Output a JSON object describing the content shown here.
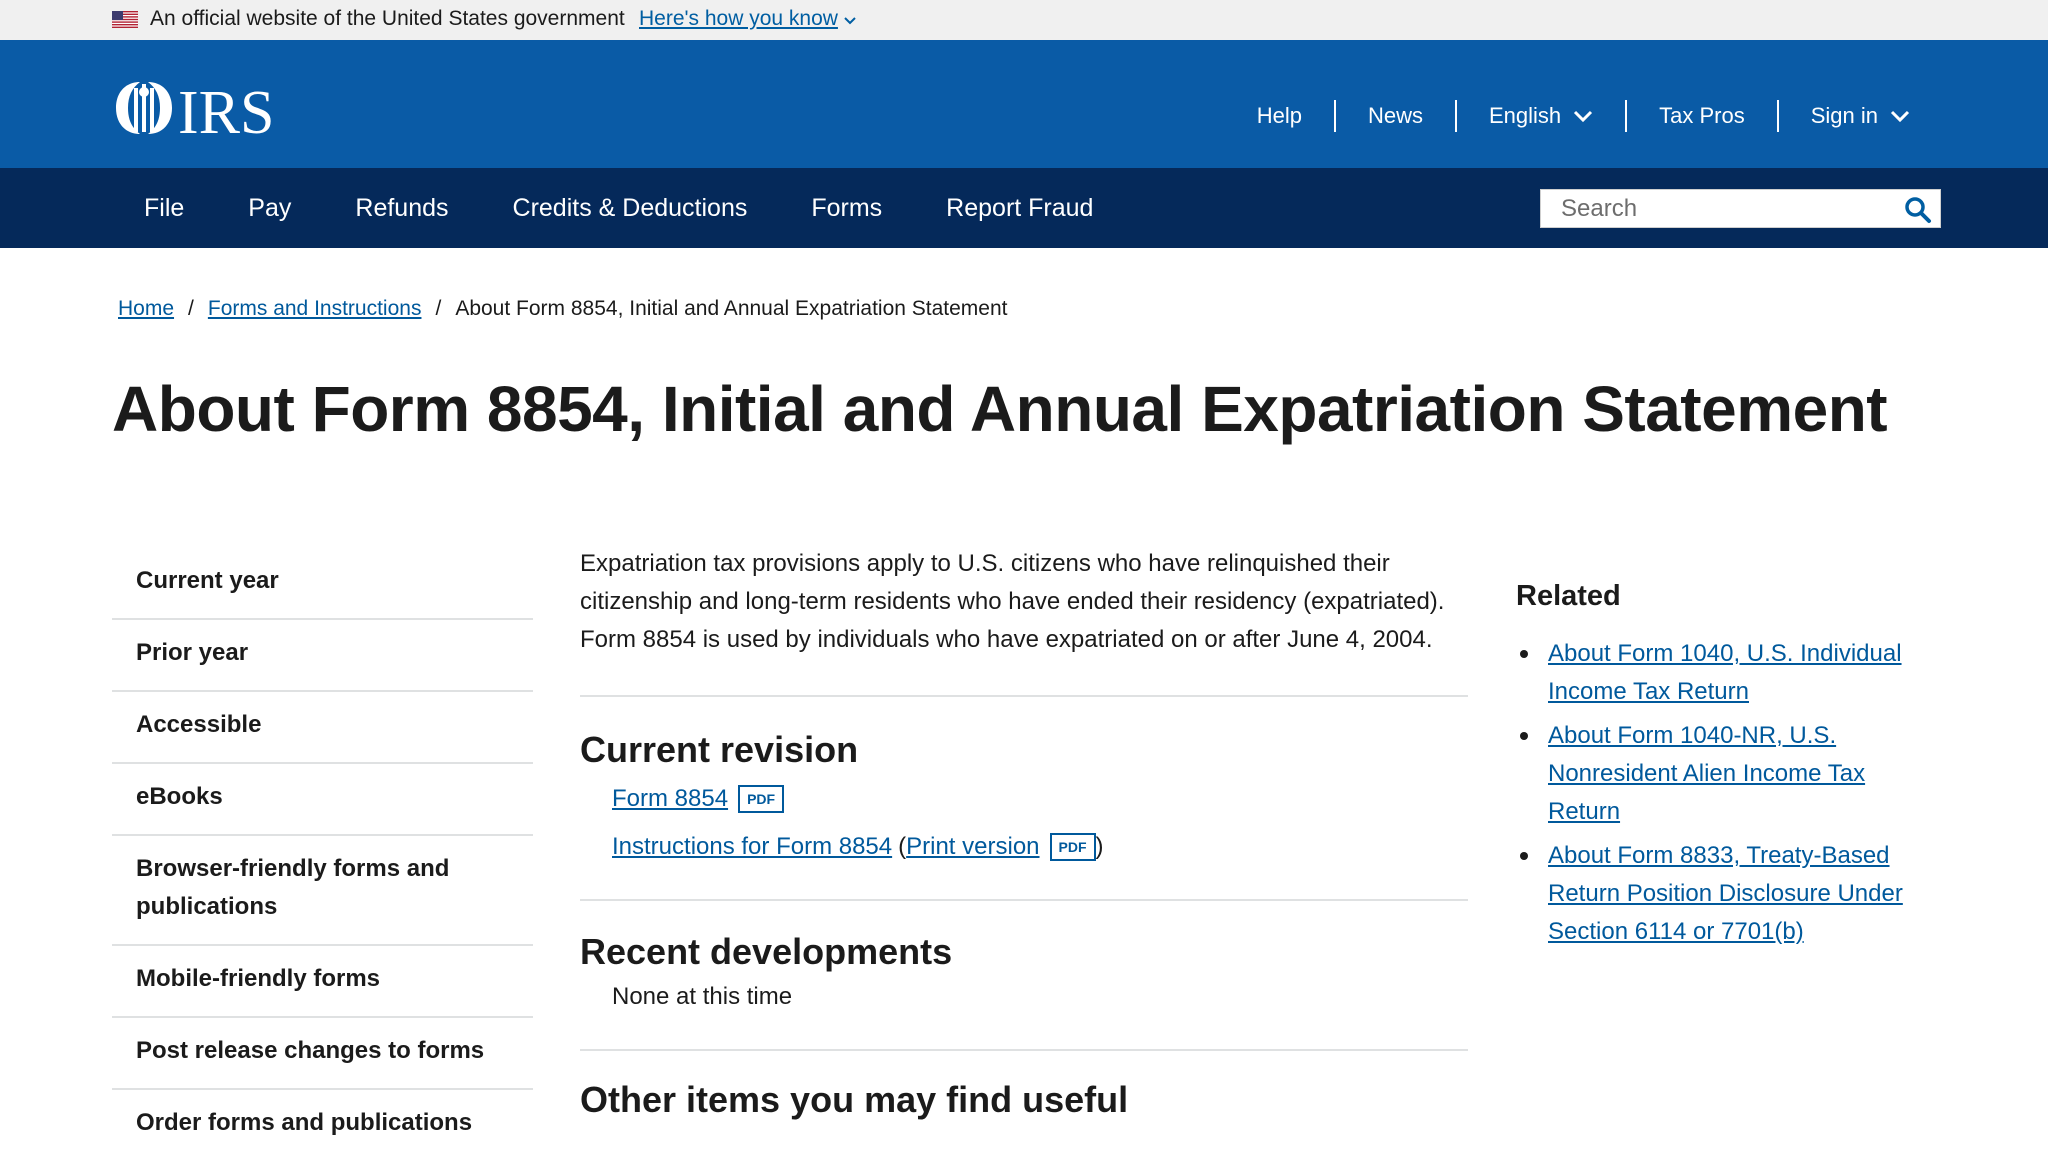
{
  "gov_banner": {
    "official_text": "An official website of the United States government",
    "how_you_know": "Here's how you know"
  },
  "header": {
    "logo_text": "IRS",
    "utility_nav": [
      {
        "label": "Help"
      },
      {
        "label": "News"
      },
      {
        "label": "English"
      },
      {
        "label": "Tax Pros"
      },
      {
        "label": "Sign in"
      }
    ]
  },
  "main_nav": {
    "items": [
      {
        "label": "File"
      },
      {
        "label": "Pay"
      },
      {
        "label": "Refunds"
      },
      {
        "label": "Credits & Deductions"
      },
      {
        "label": "Forms"
      },
      {
        "label": "Report Fraud"
      }
    ],
    "search_placeholder": "Search"
  },
  "breadcrumb": {
    "items": [
      "Home",
      "Forms and Instructions"
    ],
    "separator": "/",
    "current": "About Form 8854, Initial and Annual Expatriation Statement"
  },
  "page_title": "About Form 8854, Initial and Annual Expatriation Statement",
  "sidebar": {
    "items": [
      {
        "label": "Current year"
      },
      {
        "label": "Prior year"
      },
      {
        "label": "Accessible"
      },
      {
        "label": "eBooks"
      },
      {
        "label": "Browser-friendly forms and publications"
      },
      {
        "label": "Mobile-friendly forms"
      },
      {
        "label": "Post release changes to forms"
      },
      {
        "label": "Order forms and publications"
      }
    ]
  },
  "content": {
    "intro": "Expatriation tax provisions apply to U.S. citizens who have relinquished their citizenship and long-term residents who have ended their residency (expatriated). Form 8854 is used by individuals who have expatriated on or after June 4, 2004.",
    "current_revision": {
      "heading": "Current revision",
      "form_link": "Form 8854",
      "pdf_label": "PDF",
      "instructions_link": "Instructions for Form 8854",
      "open_paren": "(",
      "print_link": "Print version",
      "close_paren": ")"
    },
    "recent_developments": {
      "heading": "Recent developments",
      "text": "None at this time"
    },
    "other_items": {
      "heading": "Other items you may find useful"
    }
  },
  "related": {
    "title": "Related",
    "links": [
      "About Form 1040, U.S. Individual Income Tax Return",
      "About Form 1040-NR, U.S. Nonresident Alien Income Tax Return",
      "About Form 8833, Treaty-Based Return Position Disclosure Under Section 6114 or 7701(b)"
    ]
  },
  "colors": {
    "header_blue": "#0a5ba6",
    "nav_navy": "#05295a",
    "link_blue": "#00599c",
    "banner_gray": "#f0f0f0"
  }
}
